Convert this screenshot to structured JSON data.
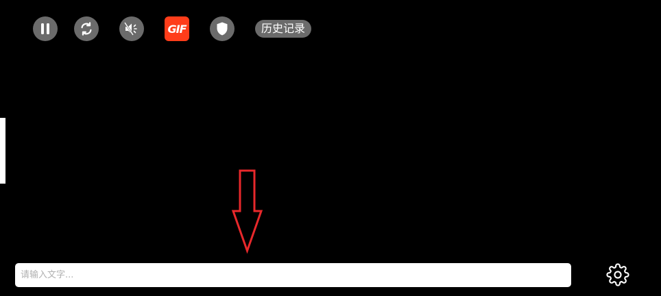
{
  "toolbar": {
    "pause_icon": "pause-icon",
    "refresh_icon": "refresh-icon",
    "mute_icon": "speaker-muted-icon",
    "gif_label": "GIF",
    "shield_icon": "shield-icon",
    "history_label": "历史记录"
  },
  "input": {
    "placeholder": "请输入文字...",
    "value": ""
  },
  "settings": {
    "icon": "gear-icon"
  },
  "colors": {
    "background": "#000000",
    "button_bg": "#6b6b6b",
    "gif_accent": "#ff3d1a",
    "arrow": "#e8282b"
  }
}
